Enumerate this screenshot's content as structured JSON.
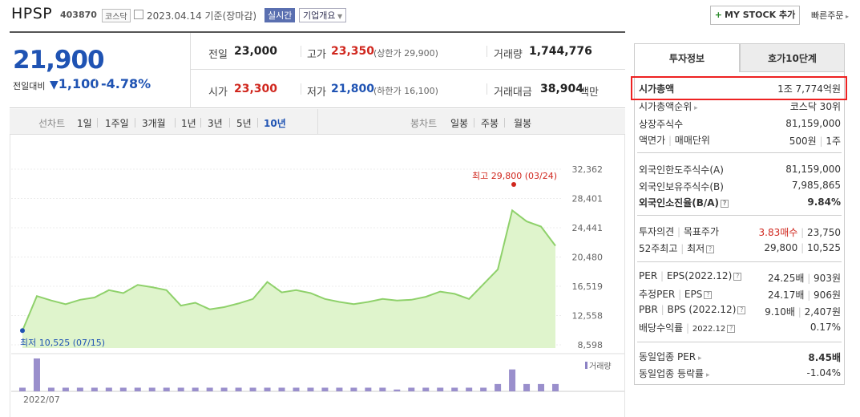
{
  "header": {
    "name": "HPSP",
    "code": "403870",
    "market": "코스닥",
    "date": "2023.04.14 기준(장마감)",
    "live_label": "실시간",
    "company_info_label": "기업개요",
    "mystock_label": "MY STOCK 추가",
    "quick_order_label": "빠른주문"
  },
  "price": {
    "current": "21,900",
    "change_label": "전일대비",
    "change": "1,100",
    "change_pct": "-4.78%",
    "prev_label": "전일",
    "prev": "23,000",
    "high_label": "고가",
    "high": "23,350",
    "upper_limit": "(상한가 29,900)",
    "volume_label": "거래량",
    "volume": "1,744,776",
    "open_label": "시가",
    "open": "23,300",
    "low_label": "저가",
    "low": "21,800",
    "lower_limit": "(하한가 16,100)",
    "amount_label": "거래대금",
    "amount": "38,904",
    "amount_unit": "백만"
  },
  "period_bar": {
    "line_label": "선차트",
    "line_periods": [
      "1일",
      "1주일",
      "3개월",
      "1년",
      "3년",
      "5년",
      "10년"
    ],
    "selected": "10년",
    "candle_label": "봉차트",
    "candle_periods": [
      "일봉",
      "주봉",
      "월봉"
    ]
  },
  "chart_data": {
    "type": "area",
    "y_ticks": [
      "32,362",
      "28,401",
      "24,441",
      "20,480",
      "16,519",
      "12,558",
      "8,598"
    ],
    "ylim": [
      8598,
      32362
    ],
    "x_tick": "2022/07",
    "max_label": "최고 29,800 (03/24)",
    "min_label": "최저 10,525 (07/15)",
    "volume_legend": "거래량",
    "line_color": "#8fd16b",
    "fill_color": "#dff4cc",
    "values": [
      10525,
      15200,
      14600,
      14100,
      14700,
      15000,
      16000,
      15600,
      16700,
      16400,
      16000,
      13900,
      14300,
      13400,
      13700,
      14200,
      14800,
      17100,
      15700,
      16000,
      15600,
      14800,
      14400,
      14100,
      14400,
      14800,
      14600,
      14700,
      15100,
      15800,
      15500,
      14800,
      16800,
      18800,
      26800,
      25300,
      24600,
      22000
    ],
    "volumes": [
      1,
      9,
      1,
      1,
      1,
      1,
      1,
      1,
      1,
      1,
      1,
      1,
      1,
      1,
      1,
      1,
      1,
      1,
      1,
      1,
      1,
      1,
      1,
      1,
      1,
      1,
      0.5,
      1,
      1,
      1,
      1,
      1,
      1,
      2,
      6,
      2,
      2,
      2
    ]
  },
  "tabs": {
    "invest_info": "투자정보",
    "hoga10": "호가10단계"
  },
  "info": {
    "market_cap_label": "시가총액",
    "market_cap": "1조 7,774억원",
    "market_cap_rank_label": "시가총액순위",
    "market_cap_rank": "코스닥 30위",
    "listed_shares_label": "상장주식수",
    "listed_shares": "81,159,000",
    "par_label": "액면가",
    "trade_unit_label": "매매단위",
    "par_value": "500원",
    "trade_unit": "1주",
    "foreign_limit_label": "외국인한도주식수(A)",
    "foreign_limit": "81,159,000",
    "foreign_hold_label": "외국인보유주식수(B)",
    "foreign_hold": "7,985,865",
    "foreign_ratio_label": "외국인소진율(B/A)",
    "foreign_ratio": "9.84%",
    "opinion_label": "투자의견",
    "target_label": "목표주가",
    "opinion": "3.83매수",
    "target": "23,750",
    "week52_label": "52주최고",
    "week52_low_label": "최저",
    "week52_high": "29,800",
    "week52_low": "10,525",
    "per_label": "PER",
    "eps_label": "EPS(2022.12)",
    "per": "24.25배",
    "eps": "903원",
    "est_per_label": "추정PER",
    "est_eps_label": "EPS",
    "est_per": "24.17배",
    "est_eps": "906원",
    "pbr_label": "PBR",
    "bps_label": "BPS (2022.12)",
    "pbr": "9.10배",
    "bps": "2,407원",
    "div_label": "배당수익률",
    "div_date": "2022.12",
    "div": "0.17%",
    "ind_per_label": "동일업종 PER",
    "ind_per": "8.45배",
    "ind_rate_label": "동일업종 등락률",
    "ind_rate": "-1.04%"
  }
}
